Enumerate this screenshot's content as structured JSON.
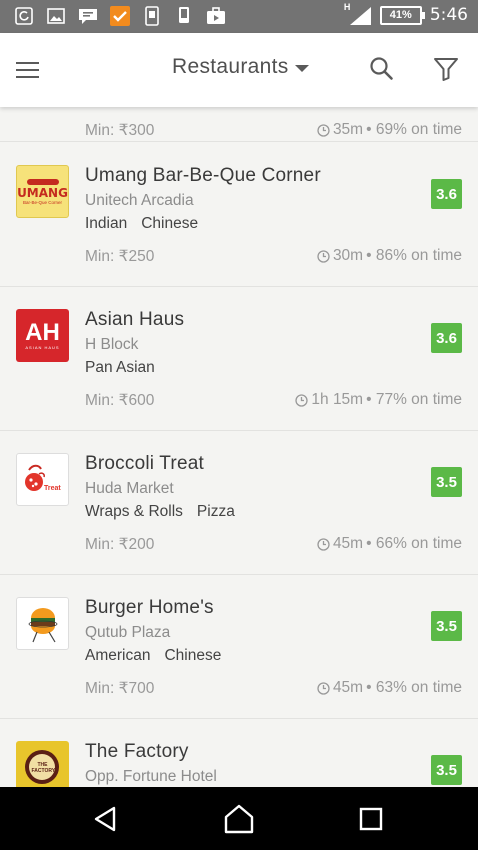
{
  "status_bar": {
    "time": "5:46",
    "battery": "41%",
    "network": "H",
    "icons": [
      "sync-icon",
      "image-icon",
      "message-icon",
      "task-app-icon",
      "phone-icon",
      "phone-android-icon",
      "briefcase-icon"
    ]
  },
  "app_bar": {
    "title": "Restaurants",
    "icons": [
      "menu-icon",
      "dropdown-caret-icon",
      "search-icon",
      "filter-icon"
    ]
  },
  "partial_item": {
    "min_order": "Min: ₹300",
    "eta": "35m",
    "on_time": " • 69% on time"
  },
  "restaurants": [
    {
      "name": "Umang Bar-Be-Que Corner",
      "locality": "Unitech Arcadia",
      "cuisines": [
        "Indian",
        "Chinese"
      ],
      "min_order": "Min: ₹250",
      "eta": "30m",
      "on_time": " • 86% on time",
      "rating": "3.6",
      "logo": {
        "icon": "umang-logo",
        "bg": "#f6e27a",
        "text": "UMANG",
        "sub": "Bar-Be-Que Corner"
      }
    },
    {
      "name": "Asian Haus",
      "locality": "H Block",
      "cuisines": [
        "Pan Asian"
      ],
      "min_order": "Min: ₹600",
      "eta": "1h 15m",
      "on_time": " • 77% on time",
      "rating": "3.6",
      "logo": {
        "icon": "asian-haus-logo",
        "bg": "#d6262b",
        "text": "AH",
        "sub": "ASIAN HAUS"
      }
    },
    {
      "name": "Broccoli Treat",
      "locality": "Huda Market",
      "cuisines": [
        "Wraps & Rolls",
        "Pizza"
      ],
      "min_order": "Min: ₹200",
      "eta": "45m",
      "on_time": " • 66% on time",
      "rating": "3.5",
      "logo": {
        "icon": "broccoli-treat-logo",
        "bg": "#ffffff",
        "text": "Treat"
      }
    },
    {
      "name": "Burger Home's",
      "locality": "Qutub Plaza",
      "cuisines": [
        "American",
        "Chinese"
      ],
      "min_order": "Min: ₹700",
      "eta": "45m",
      "on_time": " • 63% on time",
      "rating": "3.5",
      "logo": {
        "icon": "burger-home-logo",
        "bg": "#ffffff"
      }
    },
    {
      "name": "The Factory",
      "locality": "Opp. Fortune Hotel",
      "rating": "3.5",
      "logo": {
        "icon": "the-factory-logo",
        "bg": "#e8c52c",
        "text": "THE FACTORY"
      }
    }
  ],
  "nav_bar": {
    "icons": [
      "back-icon",
      "home-icon",
      "recents-icon"
    ]
  },
  "colors": {
    "rating_badge": "#5bb947",
    "status_bar": "#737373",
    "nav_bar": "#000000"
  }
}
